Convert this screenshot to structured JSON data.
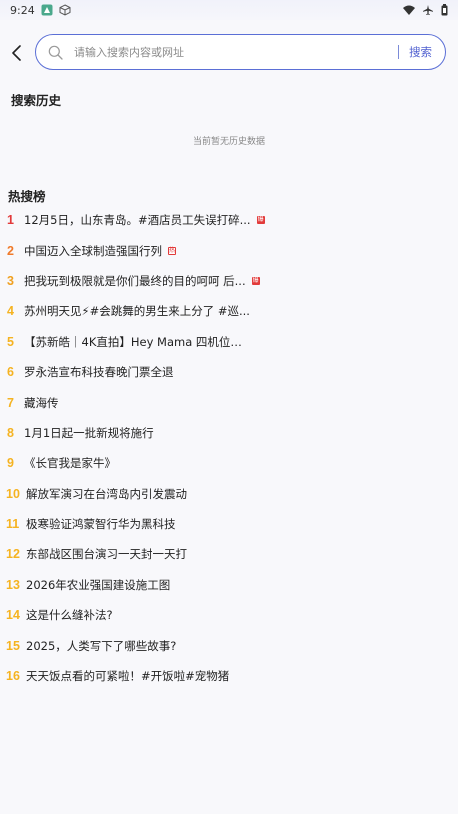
{
  "status_bar": {
    "time": "9:24"
  },
  "search": {
    "placeholder": "请输入搜索内容或网址",
    "button_label": "搜索",
    "value": ""
  },
  "history": {
    "title": "搜索历史",
    "empty_text": "当前暂无历史数据"
  },
  "hot": {
    "title": "热搜榜",
    "items": [
      {
        "rank": "1",
        "text": "12月5日，山东青岛。#酒店员工失误打碎...",
        "color": "#e23a3a",
        "badge": "爆"
      },
      {
        "rank": "2",
        "text": "中国迈入全球制造强国行列",
        "color": "#f07a2a",
        "badge": "热"
      },
      {
        "rank": "3",
        "text": "把我玩到极限就是你们最终的目的呵呵 后...",
        "color": "#f0a020",
        "badge": "爆"
      },
      {
        "rank": "4",
        "text": "苏州明天见⚡#会跳舞的男生来上分了 #巡...",
        "color": "#f5b321",
        "badge": ""
      },
      {
        "rank": "5",
        "text": "【苏新皓｜4K直拍】Hey Mama 四机位直...",
        "color": "#f5b321",
        "badge": ""
      },
      {
        "rank": "6",
        "text": "罗永浩宣布科技春晚门票全退",
        "color": "#f5b321",
        "badge": ""
      },
      {
        "rank": "7",
        "text": "藏海传",
        "color": "#f5b321",
        "badge": ""
      },
      {
        "rank": "8",
        "text": "1月1日起一批新规将施行",
        "color": "#f5b321",
        "badge": ""
      },
      {
        "rank": "9",
        "text": "《长官我是家牛》",
        "color": "#f5b321",
        "badge": ""
      },
      {
        "rank": "10",
        "text": "解放军演习在台湾岛内引发震动",
        "color": "#f5b321",
        "badge": ""
      },
      {
        "rank": "11",
        "text": "极寒验证鸿蒙智行华为黑科技",
        "color": "#f5b321",
        "badge": ""
      },
      {
        "rank": "12",
        "text": "东部战区围台演习一天封一天打",
        "color": "#f5b321",
        "badge": ""
      },
      {
        "rank": "13",
        "text": "2026年农业强国建设施工图",
        "color": "#f5b321",
        "badge": ""
      },
      {
        "rank": "14",
        "text": "这是什么缝补法?",
        "color": "#f5b321",
        "badge": ""
      },
      {
        "rank": "15",
        "text": "2025，人类写下了哪些故事?",
        "color": "#f5b321",
        "badge": ""
      },
      {
        "rank": "16",
        "text": "天天饭点看的可紧啦！#开饭啦#宠物猪",
        "color": "#f5b321",
        "badge": ""
      }
    ]
  }
}
